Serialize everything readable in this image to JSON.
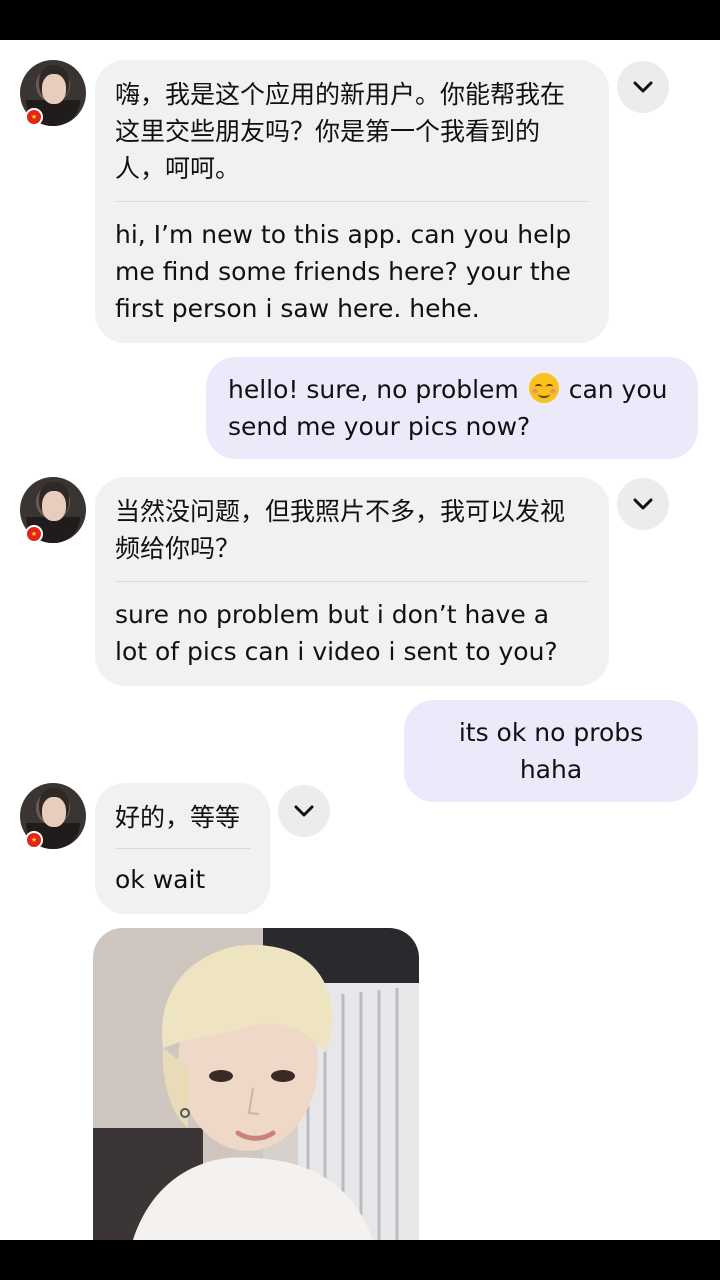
{
  "messages": [
    {
      "sender": "contact",
      "cn": "嗨，我是这个应用的新用户。你能帮我在这里交些朋友吗？你是第一个我看到的人，呵呵。",
      "en": "hi, I’m new to this app. can you help me find some friends here? your the first person i saw here. hehe."
    },
    {
      "sender": "me",
      "text_before": "hello! sure, no problem",
      "emoji": "smiling-face-emoji",
      "text_after": "can you send me your pics now?"
    },
    {
      "sender": "contact",
      "cn": "当然没问题，但我照片不多，我可以发视频给你吗？",
      "en": "sure no problem but i don’t have a lot of pics can i video i sent to you?"
    },
    {
      "sender": "me",
      "text": "its ok no probs haha"
    },
    {
      "sender": "contact",
      "cn": "好的，等等",
      "en": "ok wait"
    }
  ],
  "colors": {
    "incoming_bubble": "#f1f1f3",
    "outgoing_bubble": "#ece9fb",
    "chevron_button": "#ececee",
    "flag_badge": "#e1251b"
  },
  "icons": {
    "translate_toggle": "chevron-down-icon",
    "badge": "flag-badge-icon"
  }
}
